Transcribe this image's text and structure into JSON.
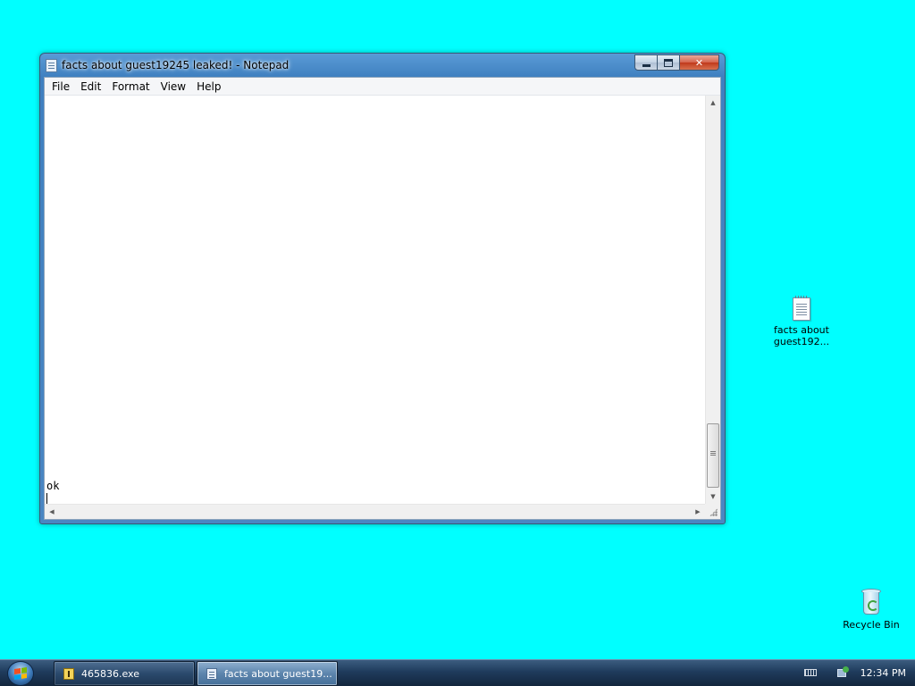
{
  "desktop": {
    "background": "#00ffff",
    "icons": [
      {
        "label": "facts about guest192...",
        "icon": "text-document-icon"
      },
      {
        "label": "Recycle Bin",
        "icon": "recycle-bin-icon"
      }
    ]
  },
  "notepad": {
    "title": "facts about guest19245 leaked! - Notepad",
    "menu": [
      "File",
      "Edit",
      "Format",
      "View",
      "Help"
    ],
    "content": "ok",
    "caption_buttons": {
      "minimize": "minimize-icon",
      "maximize": "maximize-icon",
      "close": "close-icon"
    }
  },
  "taskbar": {
    "buttons": [
      {
        "label": "465836.exe",
        "icon": "exe-icon",
        "active": false
      },
      {
        "label": "facts about guest19...",
        "icon": "notepad-icon",
        "active": true
      }
    ],
    "clock": "12:34 PM"
  }
}
